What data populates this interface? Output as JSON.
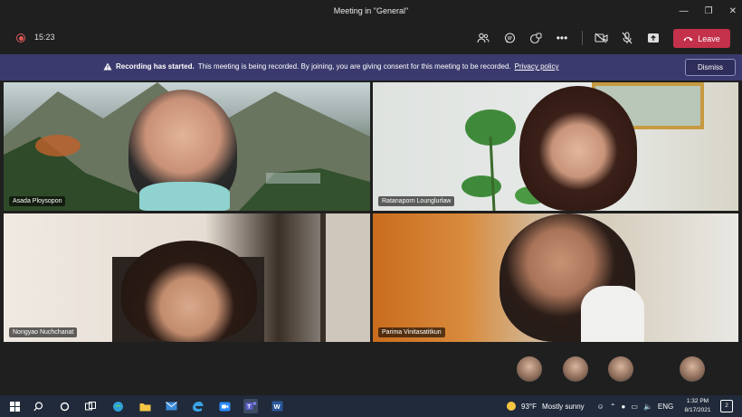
{
  "window": {
    "title": "Meeting in \"General\"",
    "controls": [
      "minimize",
      "restore",
      "close"
    ]
  },
  "toolbar": {
    "recording_icon": "record-icon",
    "elapsed": "15:23",
    "icons": [
      "people-icon",
      "chat-icon",
      "reactions-icon",
      "more-icon"
    ],
    "media_icons": [
      "camera-off-icon",
      "mic-off-icon",
      "share-icon"
    ],
    "leave_label": "Leave",
    "leave_color": "#c4314b"
  },
  "banner": {
    "strong": "Recording has started.",
    "message": "This meeting is being recorded. By joining, you are giving consent for this meeting to be recorded.",
    "link": "Privacy policy",
    "dismiss_label": "Dismiss",
    "background": "#3b3a6e"
  },
  "participants": [
    {
      "name": "Asada Ploysopon"
    },
    {
      "name": "Ratanaporn Lounglurlaw"
    },
    {
      "name": "Nongyao Nuchchanat"
    },
    {
      "name": "Parima Vinitasatitkun"
    }
  ],
  "tray_avatars": 4,
  "taskbar": {
    "apps": [
      "start-icon",
      "search-icon",
      "cortana-icon",
      "task-view-icon",
      "edge-icon",
      "file-explorer-icon",
      "mail-icon",
      "edge-legacy-icon",
      "zoom-icon",
      "teams-icon",
      "word-icon"
    ],
    "weather_temp": "93°F",
    "weather_text": "Mostly sunny",
    "language": "ENG",
    "time": "1:32 PM",
    "date": "8/17/2021",
    "notifications": "2"
  }
}
